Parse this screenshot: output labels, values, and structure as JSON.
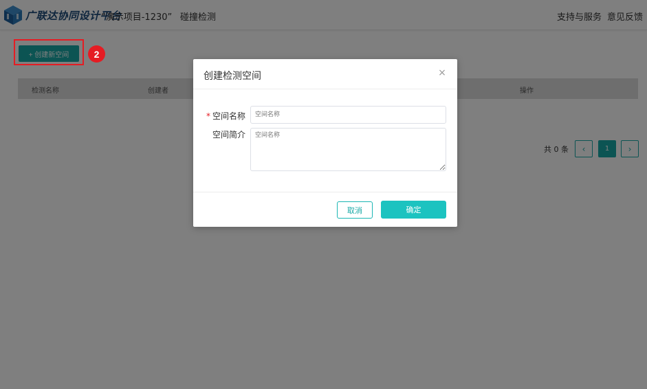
{
  "header": {
    "brand": "广联达协同设计平台",
    "project": "“演示项目-1230”",
    "nav_tab": "碰撞检测",
    "support": "支持与服务",
    "feedback": "意见反馈"
  },
  "toolbar": {
    "create_label": "+ 创建新空间",
    "step_badge": "2"
  },
  "table": {
    "columns": [
      "检测名称",
      "创建者",
      "操作"
    ]
  },
  "pager": {
    "total": "共 0 条",
    "prev": "‹",
    "page": "1",
    "next": "›"
  },
  "dialog": {
    "title": "创建检测空间",
    "close": "×",
    "required_mark": "*",
    "name_label": "空间名称",
    "name_placeholder": "空间名称",
    "intro_label": "空间简介",
    "intro_placeholder": "空间名称",
    "cancel_label": "取消",
    "ok_label": "确定"
  },
  "colors": {
    "accent": "#19a9a7",
    "confirm": "#1cc3c0",
    "highlight": "#e51c23"
  }
}
